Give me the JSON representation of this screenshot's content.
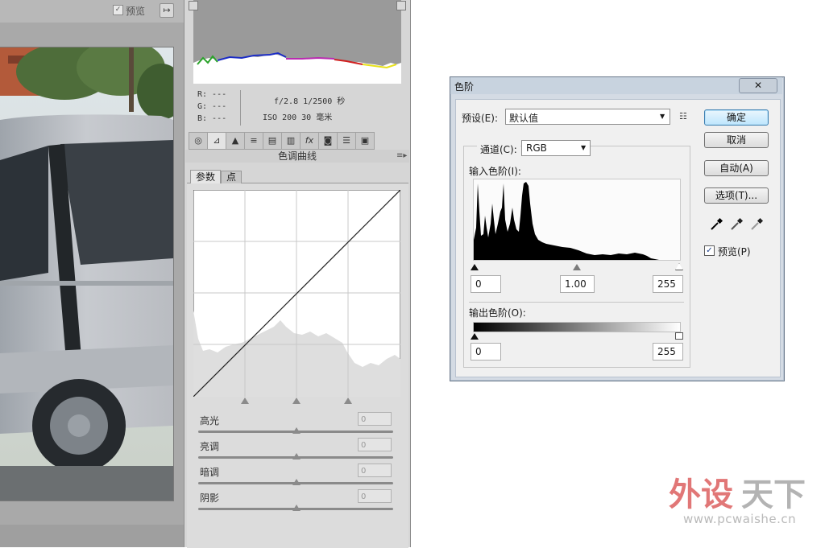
{
  "left_panel": {
    "preview_label": "预览",
    "preview_checked": true,
    "fullscreen_icon": "fullscreen-toggle-icon"
  },
  "camera_info": {
    "r": "R: ---",
    "g": "G: ---",
    "b": "B: ---",
    "aperture_shutter": "f/2.8  1/2500 秒",
    "iso_focal": "ISO 200  30 毫米"
  },
  "tool_icons": [
    "aperture-icon",
    "curve-icon",
    "detail-icon",
    "hsl-icon",
    "split-toning-icon",
    "lens-icon",
    "fx-icon",
    "camera-calibration-icon",
    "presets-icon",
    "snapshots-icon"
  ],
  "curve_panel": {
    "section_title": "色调曲线",
    "tabs": [
      {
        "label": "参数",
        "active": true
      },
      {
        "label": "点",
        "active": false
      }
    ],
    "sliders": [
      {
        "label": "高光",
        "value": "0"
      },
      {
        "label": "亮调",
        "value": "0"
      },
      {
        "label": "暗调",
        "value": "0"
      },
      {
        "label": "阴影",
        "value": "0"
      }
    ]
  },
  "levels_dialog": {
    "title": "色阶",
    "close_label": "✕",
    "preset_label": "预设(E):",
    "preset_value": "默认值",
    "channel_label": "通道(C):",
    "channel_value": "RGB",
    "input_levels_label": "输入色阶(I):",
    "input_black": "0",
    "input_gamma": "1.00",
    "input_white": "255",
    "output_levels_label": "输出色阶(O):",
    "output_black": "0",
    "output_white": "255",
    "buttons": {
      "ok": "确定",
      "cancel": "取消",
      "auto": "自动(A)",
      "options": "选项(T)..."
    },
    "eyedroppers": [
      "black-eyedropper-icon",
      "gray-eyedropper-icon",
      "white-eyedropper-icon"
    ],
    "preview_label": "预览(P)",
    "preview_checked": true
  },
  "watermark": {
    "logo_text": "外设天下",
    "site": "www.pcwaishe.cn"
  }
}
